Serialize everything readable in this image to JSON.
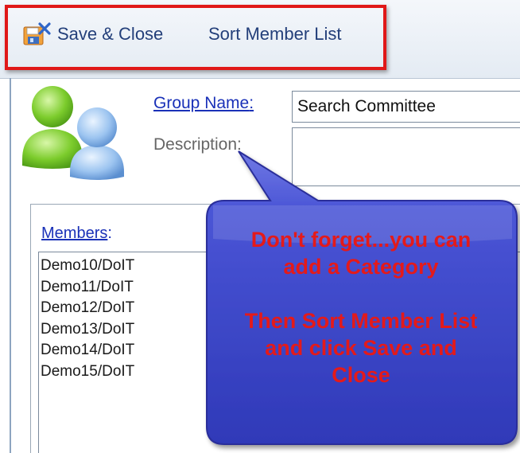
{
  "toolbar": {
    "save_close_label": "Save & Close",
    "sort_member_list_label": "Sort Member List"
  },
  "form": {
    "group_name_label": "Group Name",
    "group_name_value": "Search Committee",
    "description_label": "Description:",
    "description_value": ""
  },
  "members": {
    "label": "Members",
    "items": [
      "Demo10/DoIT",
      "Demo11/DoIT",
      "Demo12/DoIT",
      "Demo13/DoIT",
      "Demo14/DoIT",
      "Demo15/DoIT"
    ]
  },
  "callout": {
    "line1": "Don't forget...you can",
    "line2": "add a Category",
    "line3": "Then Sort Member List",
    "line4": "and click Save and",
    "line5": "Close"
  },
  "colors": {
    "highlight": "#e01818",
    "callout_fill": "#3b47c9",
    "callout_text": "#e41a1a",
    "link": "#1a31b8"
  },
  "icons": [
    "save-close-icon",
    "group-avatar-icon"
  ]
}
